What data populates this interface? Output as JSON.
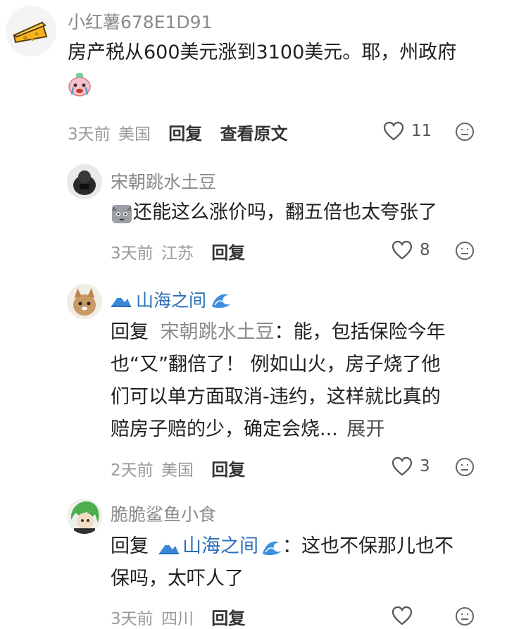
{
  "comments": [
    {
      "user": "小红薯678E1D91",
      "content_line1": "房产税从600美元涨到3100美元。耶，州政府",
      "time": "3天前",
      "location": "美国",
      "reply_label": "回复",
      "view_original_label": "查看原文",
      "likes": "11"
    },
    {
      "user": "宋朝跳水土豆",
      "content": "还能这么涨价吗，翻五倍也太夸张了",
      "time": "3天前",
      "location": "江苏",
      "reply_label": "回复",
      "likes": "8"
    },
    {
      "user": "山海之间",
      "reply_prefix": "回复",
      "reply_to": "宋朝跳水土豆",
      "content_line1": "：能，包括保险今年",
      "content_line2": "也“又”翻倍了！ 例如山火，房子烧了他",
      "content_line3": "们可以单方面取消-违约，这样就比真的",
      "content_line4": "赔房子赔的少，确定会烧...",
      "expand_label": "展开",
      "time": "2天前",
      "location": "美国",
      "reply_label": "回复",
      "likes": "3"
    },
    {
      "user": "脆脆鲨鱼小食",
      "reply_prefix": "回复",
      "reply_to": "山海之间",
      "content_line1": "：这也不保那儿也不",
      "content_line2": "保吗，太吓人了",
      "time": "3天前",
      "location": "四川",
      "reply_label": "回复"
    }
  ],
  "colors": {
    "username": "#8a8a8a",
    "text": "#1f1f1f",
    "meta": "#9a9a9a"
  }
}
